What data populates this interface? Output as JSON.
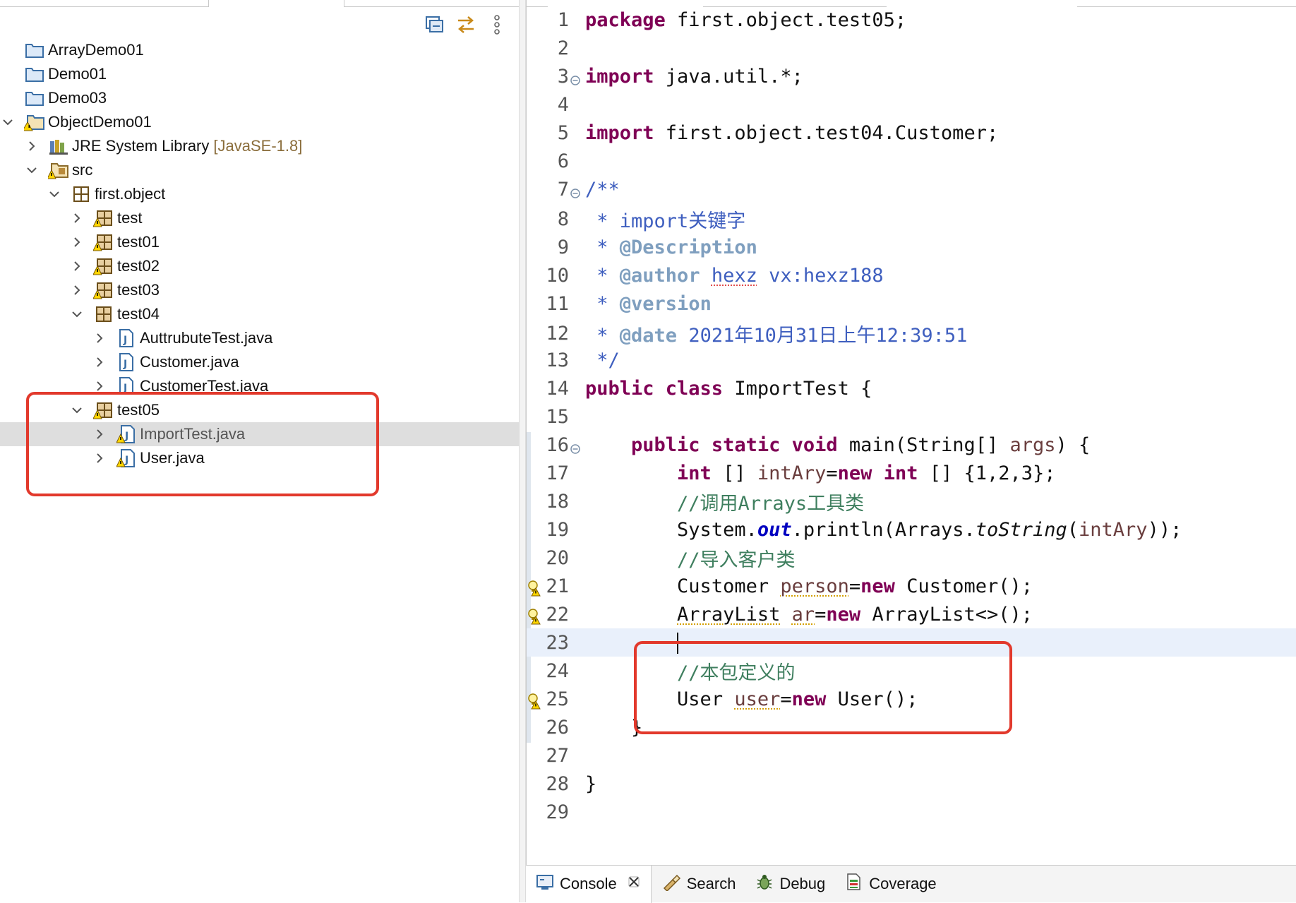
{
  "explorer": {
    "toolbar": [
      "collapse-all-icon",
      "link-with-editor-icon",
      "view-menu-icon"
    ],
    "tree": [
      {
        "label": "ArrayDemo01",
        "icon": "project-folder-icon"
      },
      {
        "label": "Demo01",
        "icon": "project-folder-icon"
      },
      {
        "label": "Demo03",
        "icon": "project-folder-icon"
      },
      {
        "label": "ObjectDemo01",
        "icon": "java-project-warning-icon",
        "expanded": true
      },
      {
        "label": "JRE System Library",
        "extra": "[JavaSE-1.8]",
        "icon": "library-icon"
      },
      {
        "label": "src",
        "icon": "source-folder-warning-icon",
        "expanded": true
      },
      {
        "label": "first.object",
        "icon": "package-icon",
        "expanded": true
      },
      {
        "label": "test",
        "icon": "package-warning-icon"
      },
      {
        "label": "test01",
        "icon": "package-warning-icon"
      },
      {
        "label": "test02",
        "icon": "package-warning-icon"
      },
      {
        "label": "test03",
        "icon": "package-warning-icon"
      },
      {
        "label": "test04",
        "icon": "package-icon",
        "expanded": true
      },
      {
        "label": "AuttrubuteTest.java",
        "icon": "java-file-icon"
      },
      {
        "label": "Customer.java",
        "icon": "java-file-icon"
      },
      {
        "label": "CustomerTest.java",
        "icon": "java-file-icon"
      },
      {
        "label": "test05",
        "icon": "package-warning-icon",
        "expanded": true
      },
      {
        "label": "ImportTest.java",
        "icon": "java-file-warning-icon",
        "selected": true
      },
      {
        "label": "User.java",
        "icon": "java-file-warning-icon"
      }
    ]
  },
  "editor": {
    "line_numbers": [
      "1",
      "2",
      "3",
      "4",
      "5",
      "6",
      "7",
      "8",
      "9",
      "10",
      "11",
      "12",
      "13",
      "14",
      "15",
      "16",
      "17",
      "18",
      "19",
      "20",
      "21",
      "22",
      "23",
      "24",
      "25",
      "26",
      "27",
      "28",
      "29"
    ],
    "code": {
      "l1_kw": "package",
      "l1_rest": " first.object.test05;",
      "l3_kw": "import",
      "l3_rest": " java.util.*;",
      "l5_kw": "import",
      "l5_rest": " first.object.test04.Customer;",
      "l7": "/**",
      "l8": " * import关键字",
      "l9_star": " * ",
      "l9_tag": "@Description",
      "l10_star": " * ",
      "l10_tag": "@author",
      "l10_sp": " ",
      "l10_name": "hexz",
      "l10_rest": " vx:hexz188",
      "l11_star": " * ",
      "l11_tag": "@version",
      "l12_star": " * ",
      "l12_tag": "@date",
      "l12_rest": " 2021年10月31日上午12:39:51",
      "l13": " */",
      "l14_kw": "public class",
      "l14_rest": " ImportTest {",
      "l16_indent": "    ",
      "l16_kw": "public static void",
      "l16_a": " main(String[] ",
      "l16_var": "args",
      "l16_b": ") {",
      "l17_indent": "        ",
      "l17_kw1": "int",
      "l17_a": " [] ",
      "l17_var": "intAry",
      "l17_eq": "=",
      "l17_kw2": "new",
      "l17_sp": " ",
      "l17_kw3": "int",
      "l17_b": " [] {1,2,3};",
      "l18_indent": "        ",
      "l18": "//调用Arrays工具类",
      "l19_indent": "        ",
      "l19_a": "System.",
      "l19_fld": "out",
      "l19_b": ".println(Arrays.",
      "l19_mth": "toString",
      "l19_c": "(",
      "l19_var": "intAry",
      "l19_d": "));",
      "l20_indent": "        ",
      "l20": "//导入客户类",
      "l21_indent": "        ",
      "l21_a": "Customer ",
      "l21_var": "person",
      "l21_eq": "=",
      "l21_kw": "new",
      "l21_b": " Customer();",
      "l22_indent": "        ",
      "l22_type": "ArrayList",
      "l22_sp": " ",
      "l22_var": "ar",
      "l22_eq": "=",
      "l22_kw": "new",
      "l22_b": " ArrayList<>();",
      "l23_indent": "        ",
      "l24_indent": "        ",
      "l24": "//本包定义的",
      "l25_indent": "        ",
      "l25_a": "User ",
      "l25_var": "user",
      "l25_eq": "=",
      "l25_kw": "new",
      "l25_b": " User();",
      "l26": "    }",
      "l28": "}"
    }
  },
  "bottom_tabs": [
    {
      "label": "Console",
      "icon": "console-icon",
      "active": true
    },
    {
      "label": "Search",
      "icon": "search-flashlight-icon"
    },
    {
      "label": "Debug",
      "icon": "debug-bug-icon"
    },
    {
      "label": "Coverage",
      "icon": "coverage-icon"
    }
  ],
  "colors": {
    "keyword": "#7f0055",
    "javadoc": "#3f5fbf",
    "javadoc_tag": "#7f9fbf",
    "line_comment": "#3f7f5f",
    "local_var": "#6a3e3e",
    "static_field": "#0000c0",
    "annotation_box": "#e2392c",
    "current_line": "#e9f0fb",
    "selection": "#dedede"
  }
}
